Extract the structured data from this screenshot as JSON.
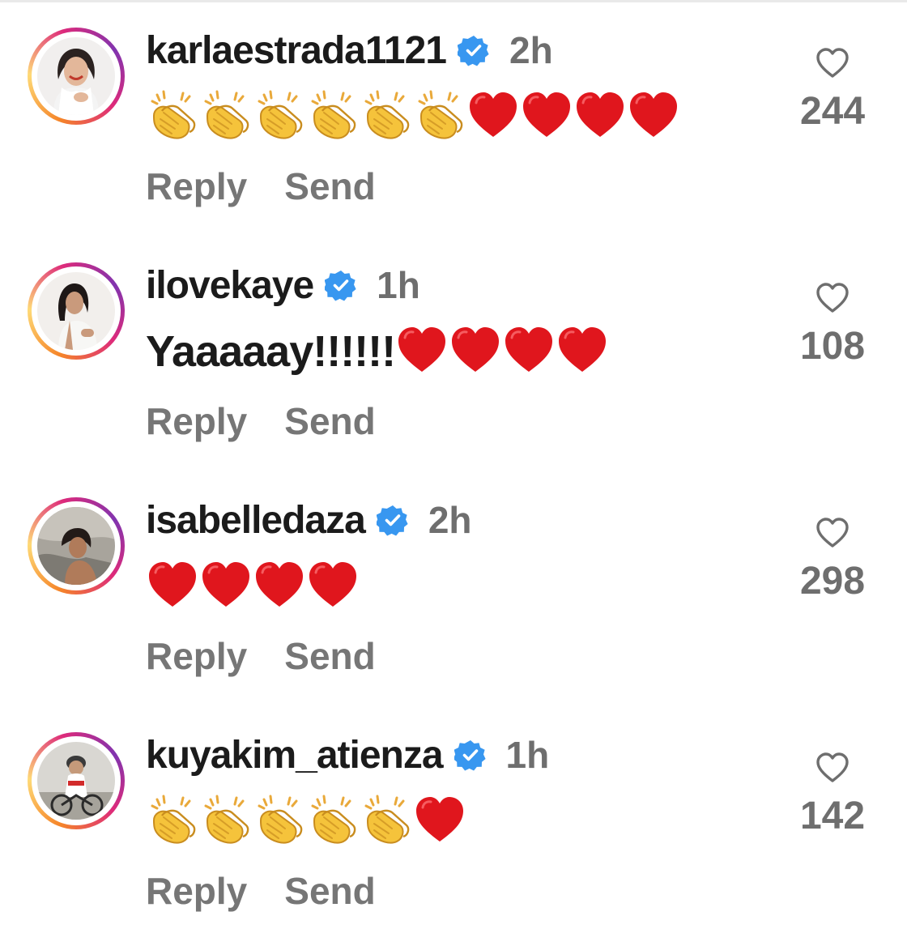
{
  "comments": [
    {
      "username": "karlaestrada1121",
      "time": "2h",
      "text": "",
      "emojis": [
        "clap",
        "clap",
        "clap",
        "clap",
        "clap",
        "clap",
        "heart",
        "heart",
        "heart",
        "heart"
      ],
      "reply_label": "Reply",
      "send_label": "Send",
      "likes": "244",
      "verified": true
    },
    {
      "username": "ilovekaye",
      "time": "1h",
      "text": "Yaaaaay!!!!!!",
      "emojis": [
        "heart",
        "heart",
        "heart",
        "heart"
      ],
      "reply_label": "Reply",
      "send_label": "Send",
      "likes": "108",
      "verified": true
    },
    {
      "username": "isabelledaza",
      "time": "2h",
      "text": "",
      "emojis": [
        "heart",
        "heart",
        "heart",
        "heart"
      ],
      "reply_label": "Reply",
      "send_label": "Send",
      "likes": "298",
      "verified": true
    },
    {
      "username": "kuyakim_atienza",
      "time": "1h",
      "text": "",
      "emojis": [
        "clap",
        "clap",
        "clap",
        "clap",
        "clap",
        "heart"
      ],
      "reply_label": "Reply",
      "send_label": "Send",
      "likes": "142",
      "verified": true
    }
  ],
  "colors": {
    "verified_blue": "#3897f0",
    "heart_red": "#e0161d",
    "clap_yellow": "#f5c33b",
    "muted_text": "#767676"
  }
}
